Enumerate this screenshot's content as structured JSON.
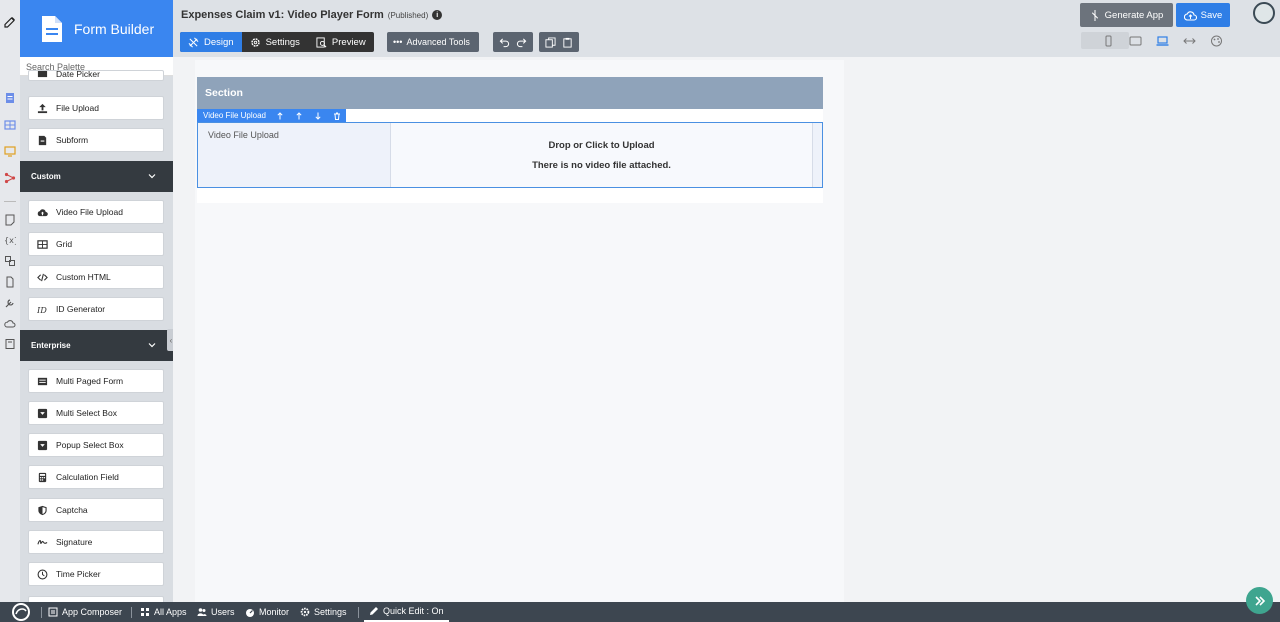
{
  "palette": {
    "title": "Form Builder",
    "search_placeholder": "Search Palette",
    "partial_item": "Date Picker",
    "items_top": [
      {
        "label": "File Upload",
        "icon": "upload-icon"
      },
      {
        "label": "Subform",
        "icon": "subform-icon"
      }
    ],
    "groups": [
      {
        "label": "Custom",
        "items": [
          {
            "label": "Video File Upload",
            "icon": "cloud-upload-icon"
          },
          {
            "label": "Grid",
            "icon": "grid-icon"
          },
          {
            "label": "Custom HTML",
            "icon": "code-icon"
          },
          {
            "label": "ID Generator",
            "icon": "id-icon"
          }
        ]
      },
      {
        "label": "Enterprise",
        "items": [
          {
            "label": "Multi Paged Form",
            "icon": "pages-icon"
          },
          {
            "label": "Multi Select Box",
            "icon": "select-box-icon"
          },
          {
            "label": "Popup Select Box",
            "icon": "popup-select-icon"
          },
          {
            "label": "Calculation Field",
            "icon": "calculator-icon"
          },
          {
            "label": "Captcha",
            "icon": "shield-icon"
          },
          {
            "label": "Signature",
            "icon": "signature-icon"
          },
          {
            "label": "Time Picker",
            "icon": "clock-icon"
          }
        ]
      }
    ]
  },
  "header": {
    "form_title": "Expenses Claim v1: Video Player Form",
    "status": "(Published)",
    "tabs": [
      {
        "label": "Design",
        "icon": "design-icon",
        "active": true
      },
      {
        "label": "Settings",
        "icon": "gear-icon",
        "active": false
      },
      {
        "label": "Preview",
        "icon": "preview-icon",
        "active": false
      }
    ],
    "advanced_tools": "Advanced Tools",
    "generate_app": "Generate App",
    "save": "Save"
  },
  "canvas": {
    "section_title": "Section",
    "field_toolbar_label": "Video File Upload",
    "field_label": "Video File Upload",
    "upload_prompt": "Drop or Click to Upload",
    "upload_status": "There is no video file attached."
  },
  "bottombar": {
    "items": [
      {
        "label": "App Composer",
        "icon": "composer-icon"
      },
      {
        "label": "All Apps",
        "icon": "apps-grid-icon"
      },
      {
        "label": "Users",
        "icon": "users-icon"
      },
      {
        "label": "Monitor",
        "icon": "monitor-icon"
      },
      {
        "label": "Settings",
        "icon": "gear-icon"
      }
    ],
    "quick_edit": "Quick Edit : On"
  },
  "colors": {
    "primary": "#2f7ee6",
    "group_header": "#343a40",
    "section_header": "#8fa3ba",
    "bottom_bar": "#3d4650",
    "fab": "#3fa58f"
  }
}
